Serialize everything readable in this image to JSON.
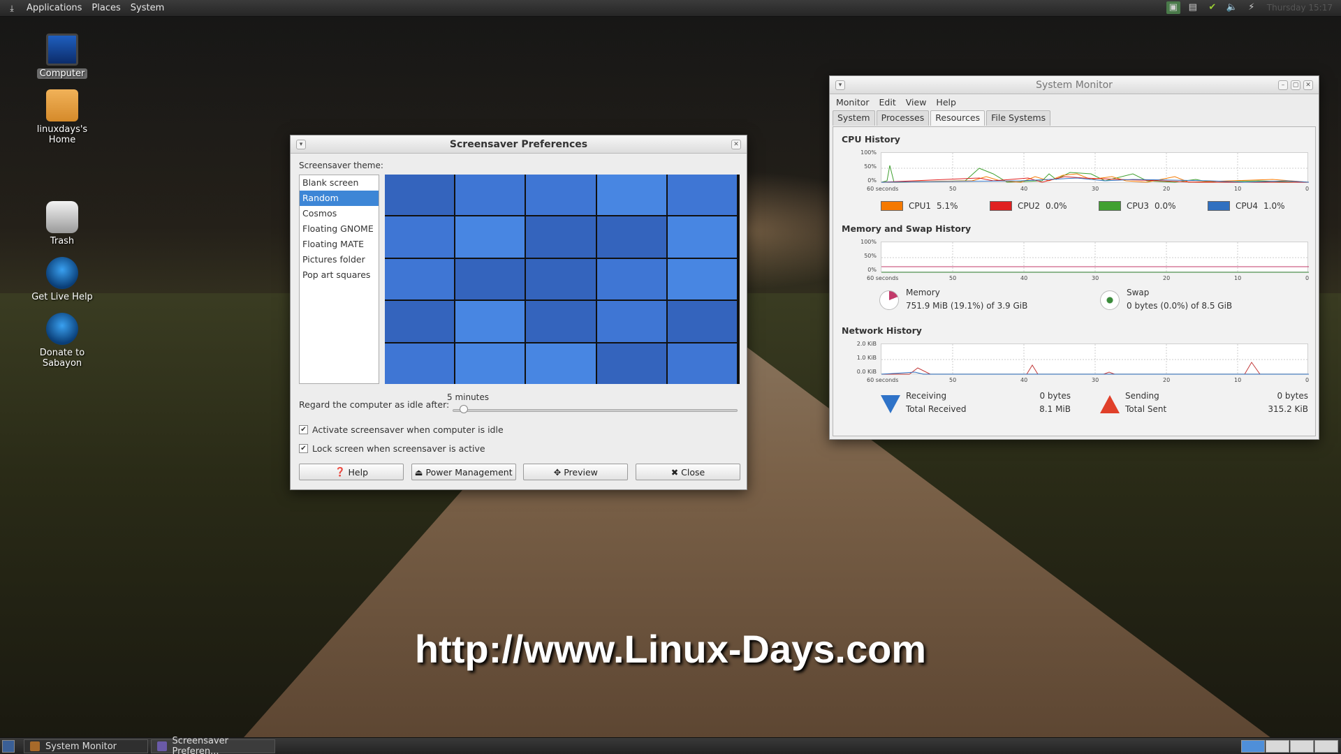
{
  "top_panel": {
    "menu": [
      "Applications",
      "Places",
      "System"
    ],
    "clock": "Thursday 15:17"
  },
  "desktop_icons": [
    {
      "label": "Computer"
    },
    {
      "label": "linuxdays's Home"
    },
    {
      "label": "Trash"
    },
    {
      "label": "Get Live Help"
    },
    {
      "label": "Donate to Sabayon"
    }
  ],
  "screensaver": {
    "title": "Screensaver Preferences",
    "theme_label": "Screensaver theme:",
    "themes": [
      "Blank screen",
      "Random",
      "Cosmos",
      "Floating GNOME",
      "Floating MATE",
      "Pictures folder",
      "Pop art squares"
    ],
    "selected_theme": "Random",
    "idle_label": "Regard the computer as idle after:",
    "idle_value": "5 minutes",
    "idle_slider_fraction": 0.02,
    "activate_label": "Activate screensaver when computer is idle",
    "activate_checked": true,
    "lock_label": "Lock screen when screensaver is active",
    "lock_checked": true,
    "buttons": {
      "help": "Help",
      "power": "Power Management",
      "preview": "Preview",
      "close": "Close"
    }
  },
  "system_monitor": {
    "title": "System Monitor",
    "menu": [
      "Monitor",
      "Edit",
      "View",
      "Help"
    ],
    "tabs": [
      "System",
      "Processes",
      "Resources",
      "File Systems"
    ],
    "active_tab": "Resources",
    "x_ticks": [
      "60 seconds",
      "50",
      "40",
      "30",
      "20",
      "10",
      "0"
    ],
    "cpu": {
      "title": "CPU History",
      "y_ticks": [
        "100%",
        "50%",
        "0%"
      ],
      "legend": [
        {
          "name": "CPU1",
          "value": "5.1%",
          "color": "#f57900"
        },
        {
          "name": "CPU2",
          "value": "0.0%",
          "color": "#e02020"
        },
        {
          "name": "CPU3",
          "value": "0.0%",
          "color": "#40a030"
        },
        {
          "name": "CPU4",
          "value": "1.0%",
          "color": "#3070c0"
        }
      ]
    },
    "memory": {
      "title": "Memory and Swap History",
      "y_ticks": [
        "100%",
        "50%",
        "0%"
      ],
      "memory_label": "Memory",
      "memory_value": "751.9 MiB (19.1%) of 3.9 GiB",
      "swap_label": "Swap",
      "swap_value": "0 bytes (0.0%) of 8.5 GiB",
      "memory_color": "#c23a6a",
      "swap_color": "#3a8a3a"
    },
    "network": {
      "title": "Network History",
      "y_ticks": [
        "2.0 KiB",
        "1.0 KiB",
        "0.0 KiB"
      ],
      "receiving_label": "Receiving",
      "receiving_value": "0 bytes",
      "total_received_label": "Total Received",
      "total_received_value": "8.1 MiB",
      "sending_label": "Sending",
      "sending_value": "0 bytes",
      "total_sent_label": "Total Sent",
      "total_sent_value": "315.2 KiB"
    }
  },
  "watermark": "http://www.Linux-Days.com",
  "taskbar": {
    "tasks": [
      "System Monitor",
      "Screensaver Preferen..."
    ]
  }
}
